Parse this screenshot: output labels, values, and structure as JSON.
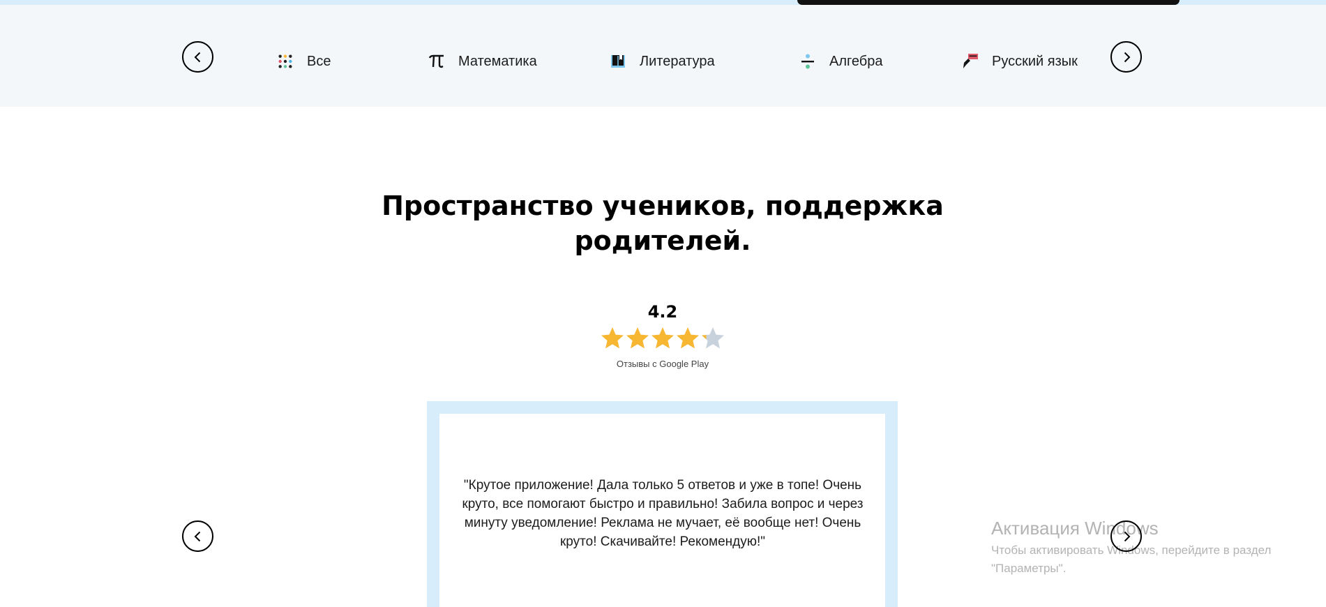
{
  "subjects_nav": {
    "prev_label": "‹",
    "next_label": "›",
    "items": [
      {
        "label": "Все",
        "icon": "dots-grid-icon"
      },
      {
        "label": "Математика",
        "icon": "pi-icon"
      },
      {
        "label": "Литература",
        "icon": "book-icon"
      },
      {
        "label": "Алгебра",
        "icon": "divide-icon"
      },
      {
        "label": "Русский язык",
        "icon": "pen-rus-icon"
      }
    ]
  },
  "reviews_section": {
    "title": "Пространство учеников, поддержка родителей.",
    "rating_value": "4.2",
    "rating_stars": 4.2,
    "rating_max": 5,
    "rating_source": "Отзывы с Google Play",
    "review_text": "\"Крутое приложение! Дала только 5 ответов и уже в топе! Очень круто, все помогают быстро и правильно! Забила вопрос и через минуту уведомление! Реклама не мучает, её вообще нет! Очень круто! Скачивайте! Рекомендую!\""
  },
  "windows_watermark": {
    "title": "Активация Windows",
    "text": "Чтобы активировать Windows, перейдите в раздел \"Параметры\"."
  },
  "colors": {
    "bar_background": "#f3f7fa",
    "frame_blue": "#d8edfb",
    "star_filled": "#f7b733",
    "star_empty": "#c7d2dc"
  }
}
